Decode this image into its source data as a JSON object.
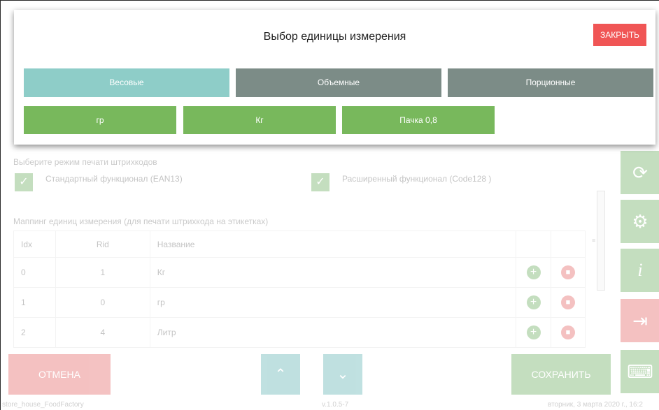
{
  "modal": {
    "title": "Выбор единицы измерения",
    "close_label": "ЗАКРЫТЬ",
    "categories": [
      {
        "label": "Весовые",
        "active": true
      },
      {
        "label": "Объемные",
        "active": false
      },
      {
        "label": "Порционные",
        "active": false
      }
    ],
    "units": [
      "гр",
      "Кг",
      "Пачка 0,8"
    ]
  },
  "barcode": {
    "section_label": "Выберите режим печати штрихкодов",
    "option_standard": "Стандартный функционал (EAN13)",
    "option_extended": "Расширенный функционал (Code128 )"
  },
  "mapping": {
    "section_label": "Маппинг единиц измерения (для печати штрихкода на этикетках)",
    "headers": [
      "Idx",
      "Rid",
      "Название"
    ],
    "rows": [
      {
        "idx": "0",
        "rid": "1",
        "name": "Кг"
      },
      {
        "idx": "1",
        "rid": "0",
        "name": "гр"
      },
      {
        "idx": "2",
        "rid": "4",
        "name": "Литр"
      }
    ]
  },
  "footer": {
    "cancel_label": "ОТМЕНА",
    "save_label": "СОХРАНИТЬ"
  },
  "status": {
    "app_name": "store_house_FoodFactory",
    "version": "v.1.0.5-7",
    "datetime": "вторник, 3 марта 2020 г., 16:2"
  },
  "colors": {
    "green": "#5aa34a",
    "red": "#e05050",
    "teal": "#4aa8a8",
    "active_tab": "#8ecdc8",
    "inactive_tab": "#7c8c87"
  }
}
